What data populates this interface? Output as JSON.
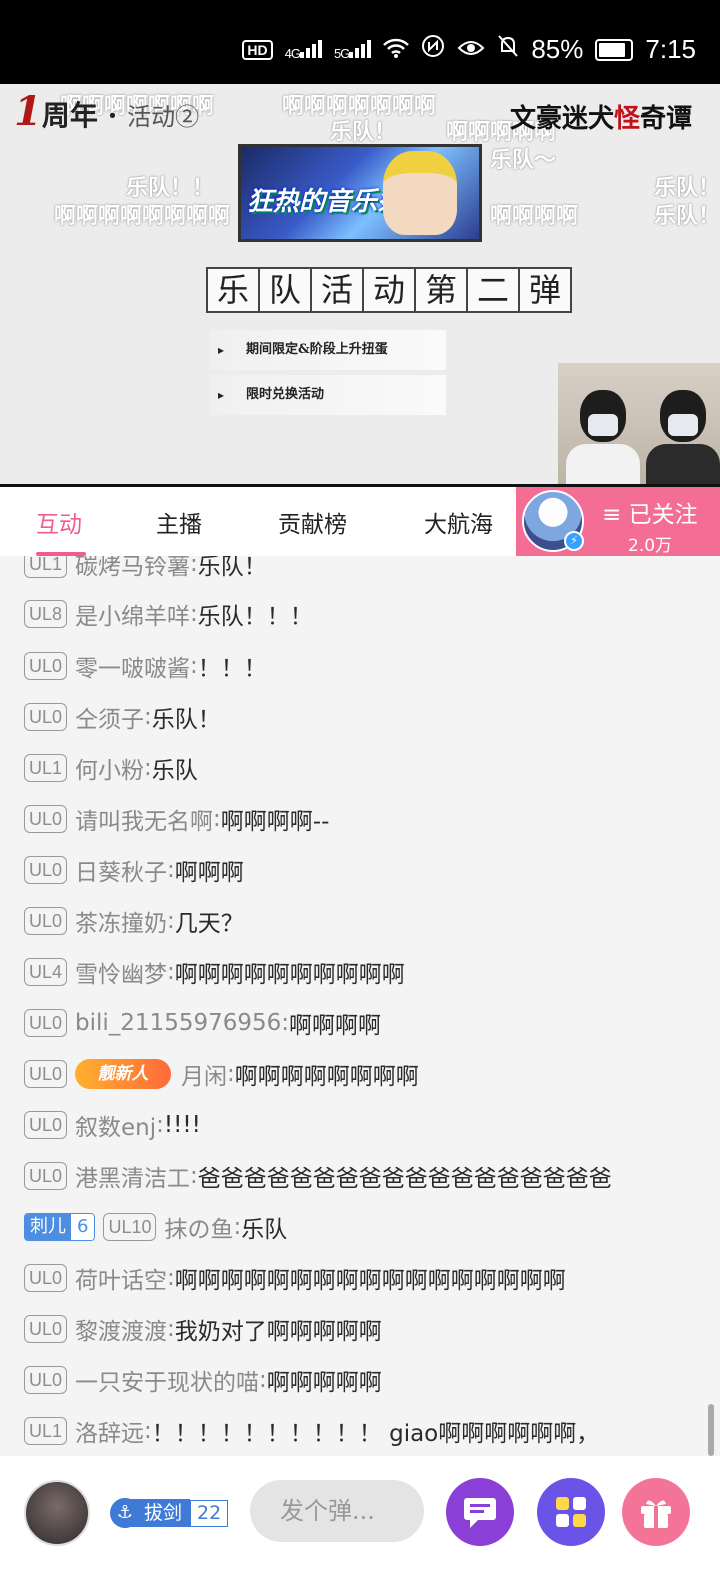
{
  "status_bar": {
    "network_hd": "HD",
    "signal1": "4G",
    "signal2": "5G",
    "battery": "85%",
    "time": "7:15",
    "icons": [
      "nfc-icon",
      "eye-icon",
      "mute-icon",
      "wifi-icon",
      "battery-icon"
    ]
  },
  "video": {
    "anniv_big": "1",
    "anniv_text": "周年",
    "anniv_sub": "活动②",
    "game_logo_a": "文豪迷犬",
    "game_logo_b": "怪",
    "game_logo_c": "奇谭",
    "banner_title": "狂热的音乐祭",
    "title_chars": [
      "乐",
      "队",
      "活",
      "动",
      "第",
      "二",
      "弹"
    ],
    "menu_items": [
      "期间限定&阶段上升扭蛋",
      "限时兑换活动"
    ],
    "overlay_danmaku": [
      "啊啊啊啊啊啊啊",
      "乐队！",
      "啊啊啊啊啊",
      "乐队～",
      "乐队！！",
      "乐队！",
      "啊啊啊啊啊啊啊啊",
      "啊啊啊啊",
      "乐队！",
      "乐队！"
    ]
  },
  "tabs": {
    "items": [
      "互动",
      "主播",
      "贡献榜",
      "大航海"
    ],
    "active": "互动",
    "follow_label": "≡ 已关注",
    "follower_count": "2.0万"
  },
  "chat": {
    "messages": [
      {
        "level": "UL1",
        "user": "碳烤马铃薯",
        "text": "乐队！"
      },
      {
        "level": "UL8",
        "user": "是小绵羊咩",
        "text": "乐队！！！"
      },
      {
        "level": "UL0",
        "user": "零一啵啵酱",
        "text": "！！！"
      },
      {
        "level": "UL0",
        "user": "仝须子",
        "text": "乐队！"
      },
      {
        "level": "UL1",
        "user": "何小粉",
        "text": "乐队"
      },
      {
        "level": "UL0",
        "user": "请叫我无名啊",
        "text": "啊啊啊啊--"
      },
      {
        "level": "UL0",
        "user": "日葵秋子",
        "text": "啊啊啊"
      },
      {
        "level": "UL0",
        "user": "茶冻撞奶",
        "text": "几天？"
      },
      {
        "level": "UL4",
        "user": "雪怜幽梦",
        "text": "啊啊啊啊啊啊啊啊啊啊"
      },
      {
        "level": "UL0",
        "user": "bili_21155976956",
        "text": "啊啊啊啊"
      },
      {
        "level": "UL0",
        "badge": "靓新人",
        "user": "月闲",
        "text": "啊啊啊啊啊啊啊啊"
      },
      {
        "level": "UL0",
        "user": "叙数enj",
        "text": "!!!!"
      },
      {
        "level": "UL0",
        "user": "港黑清洁工",
        "text": "爸爸爸爸爸爸爸爸爸爸爸爸爸爸爸爸爸爸"
      },
      {
        "fan_name": "刺儿",
        "fan_level": "6",
        "level": "UL10",
        "user": "抹の鱼",
        "text": "乐队"
      },
      {
        "level": "UL0",
        "user": "荷叶话空",
        "text": "啊啊啊啊啊啊啊啊啊啊啊啊啊啊啊啊啊"
      },
      {
        "level": "UL0",
        "user": "黎渡渡渡",
        "text": "我奶对了啊啊啊啊啊"
      },
      {
        "level": "UL0",
        "user": "一只安于现状的喵",
        "text": "啊啊啊啊啊"
      },
      {
        "level": "UL1",
        "user": "洛辞远",
        "text": "！！！！！！！！！！ giao啊啊啊啊啊啊，"
      }
    ]
  },
  "bottom_bar": {
    "medal_name": "拔剑",
    "medal_level": "22",
    "danmu_placeholder": "发个弹...",
    "buttons": [
      "message-icon",
      "apps-icon",
      "gift-icon"
    ]
  },
  "colors": {
    "accent": "#f25d8e",
    "follow_bg": "#f36d94",
    "fan_badge": "#4d8ee0"
  }
}
